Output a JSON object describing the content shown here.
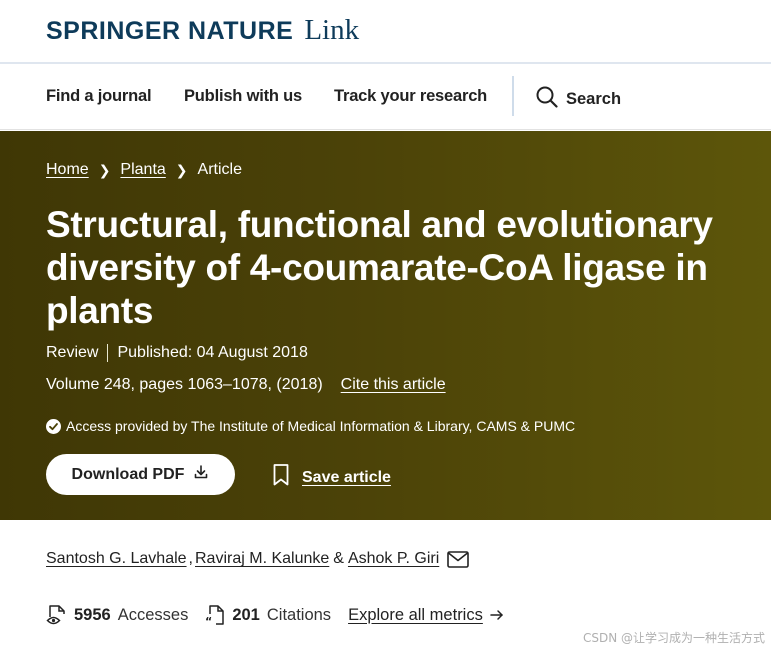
{
  "brand": {
    "name": "SPRINGER NATURE",
    "link": "Link"
  },
  "nav": {
    "items": [
      "Find a journal",
      "Publish with us",
      "Track your research"
    ],
    "search_label": "Search"
  },
  "breadcrumb": {
    "home": "Home",
    "journal": "Planta",
    "current": "Article"
  },
  "article": {
    "title": "Structural, functional and evolutionary diversity of 4-coumarate-CoA ligase in plants",
    "type": "Review",
    "published": "Published: 04 August 2018",
    "volume": "Volume 248, pages 1063–1078, (2018)",
    "cite_label": "Cite this article",
    "access": "Access provided by The Institute of Medical Information & Library, CAMS & PUMC",
    "download_label": "Download PDF",
    "save_label": "Save article"
  },
  "authors": {
    "list": [
      "Santosh G. Lavhale",
      "Raviraj M. Kalunke",
      "Ashok P. Giri"
    ],
    "sep1": ",",
    "sep2": "&"
  },
  "metrics": {
    "accesses_num": "5956",
    "accesses_label": "Accesses",
    "citations_num": "201",
    "citations_label": "Citations",
    "explore_label": "Explore all metrics"
  },
  "watermark": "CSDN @让学习成为一种生活方式",
  "colors": {
    "brand": "#0e3b5a",
    "hero_start": "#3f3705",
    "hero_end": "#5d560a"
  },
  "icons": [
    "search-icon",
    "check-circle-icon",
    "download-icon",
    "bookmark-icon",
    "mail-icon",
    "eye-document-icon",
    "quote-document-icon",
    "arrow-right-icon"
  ]
}
